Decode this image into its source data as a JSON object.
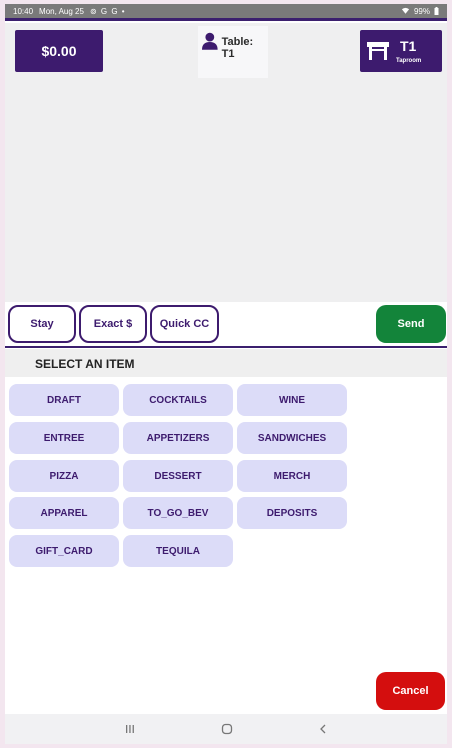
{
  "status_bar": {
    "time": "10:40",
    "date": "Mon, Aug 25",
    "notification_icons": "⊚ G G •",
    "battery": "99%"
  },
  "header": {
    "balance": "$0.00",
    "table_label": "Table: T1",
    "table_code": "T1",
    "table_area": "Taproom"
  },
  "payment": {
    "buttons": [
      "Stay",
      "Exact $",
      "Quick CC"
    ],
    "send_label": "Send"
  },
  "menu": {
    "title": "SELECT AN ITEM",
    "categories": [
      "DRAFT",
      "COCKTAILS",
      "WINE",
      "ENTREE",
      "APPETIZERS",
      "SANDWICHES",
      "PIZZA",
      "DESSERT",
      "MERCH",
      "APPAREL",
      "TO_GO_BEV",
      "DEPOSITS",
      "GIFT_CARD",
      "TEQUILA"
    ]
  },
  "cancel_label": "Cancel",
  "colors": {
    "primary": "#3d1b6e",
    "send": "#13843a",
    "cancel": "#d40e0e",
    "category_bg": "#dcdcf8"
  },
  "icons": {
    "person": "person-icon",
    "table": "table-icon",
    "nav_recents": "recents-icon",
    "nav_home": "home-icon",
    "nav_back": "back-icon"
  }
}
